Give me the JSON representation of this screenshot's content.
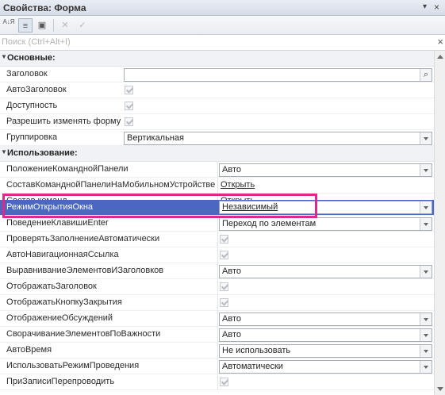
{
  "window": {
    "title": "Свойства: Форма",
    "menu_glyph": "▾",
    "close_glyph": "×"
  },
  "toolbar": {
    "sort_az": "А↓Я",
    "categories_icon": "≡",
    "pin_icon": "▣",
    "cancel_icon": "✕",
    "apply_icon": "✓"
  },
  "search": {
    "placeholder": "Поиск (Ctrl+Alt+I)",
    "clear": "×"
  },
  "sections": {
    "main": {
      "label": "Основные:"
    },
    "usage": {
      "label": "Использование:"
    }
  },
  "props": {
    "zagolovok": {
      "label": "Заголовок",
      "value": ""
    },
    "avtozagolovok": {
      "label": "АвтоЗаголовок",
      "checked": true
    },
    "dostupnost": {
      "label": "Доступность",
      "checked": true
    },
    "razreshit": {
      "label": "Разрешить изменять форму",
      "checked": true
    },
    "gruppirovka": {
      "label": "Группировка",
      "value": "Вертикальная"
    },
    "polozhenie": {
      "label": "ПоложениеКоманднойПанели",
      "value": "Авто"
    },
    "sostav_mob": {
      "label": "СоставКоманднойПанелиНаМобильномУстройстве",
      "value": "Открыть"
    },
    "sostav_komand": {
      "label": "Состав команд",
      "value": "Открыть"
    },
    "rezhim": {
      "label": "РежимОткрытияОкна",
      "value": "Независимый"
    },
    "povedenie": {
      "label": "ПоведениеКлавишиEnter",
      "value": "Переход по элементам"
    },
    "proveryat": {
      "label": "ПроверятьЗаполнениеАвтоматически",
      "checked": true
    },
    "avtonav": {
      "label": "АвтоНавигационнаяСсылка",
      "checked": true
    },
    "vyravnivanie": {
      "label": "ВыравниваниеЭлементовИЗаголовков",
      "value": "Авто"
    },
    "otobr_zag": {
      "label": "ОтображатьЗаголовок",
      "checked": true
    },
    "otobr_knopku": {
      "label": "ОтображатьКнопкуЗакрытия",
      "checked": true
    },
    "otobr_obsuzh": {
      "label": "ОтображениеОбсуждений",
      "value": "Авто"
    },
    "svorach": {
      "label": "СворачиваниеЭлементовПоВажности",
      "value": "Авто"
    },
    "avtovremya": {
      "label": "АвтоВремя",
      "value": "Не использовать"
    },
    "ispolz_rezhim": {
      "label": "ИспользоватьРежимПроведения",
      "value": "Автоматически"
    },
    "pri_zapisi": {
      "label": "ПриЗаписиПерепроводить",
      "checked": true
    }
  },
  "colors": {
    "selection": "#4b67c1",
    "highlight_frame": "#e0288a"
  }
}
